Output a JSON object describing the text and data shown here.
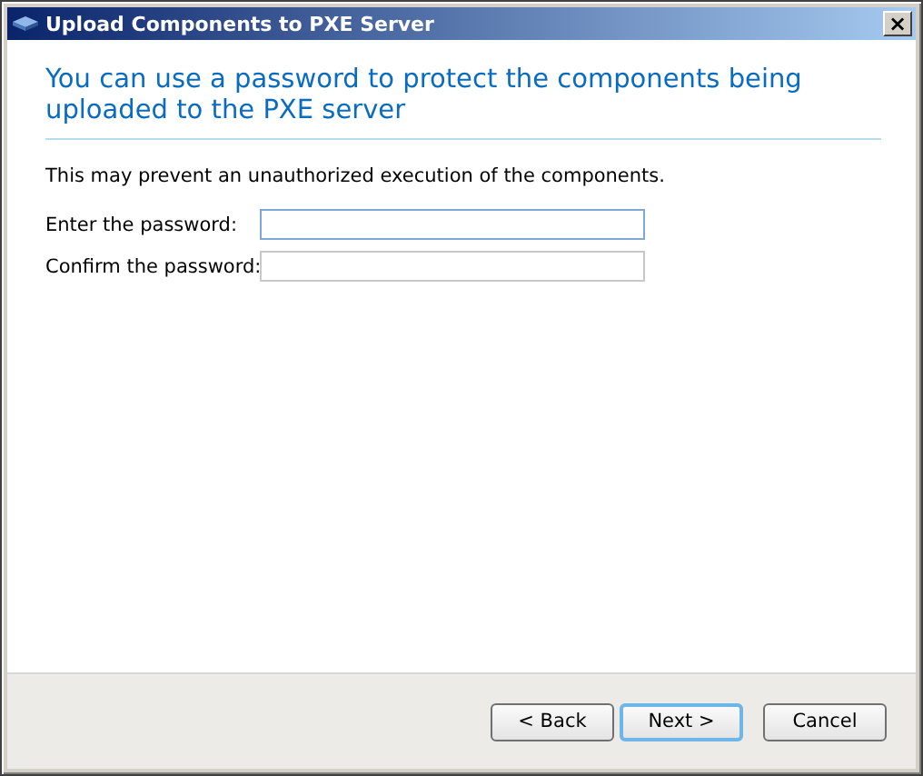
{
  "window": {
    "title": "Upload Components to PXE Server",
    "close": "×"
  },
  "heading": "You can use a password to protect the components being uploaded to the PXE server",
  "description": "This may prevent an unauthorized execution of the components.",
  "fields": [
    {
      "label": "Enter the password:",
      "focused": true
    },
    {
      "label": "Confirm the password:",
      "focused": false
    }
  ],
  "buttons": [
    {
      "label": "< Back",
      "default": false
    },
    {
      "label": "Next >",
      "default": true
    },
    {
      "label": "Cancel",
      "default": false
    }
  ]
}
